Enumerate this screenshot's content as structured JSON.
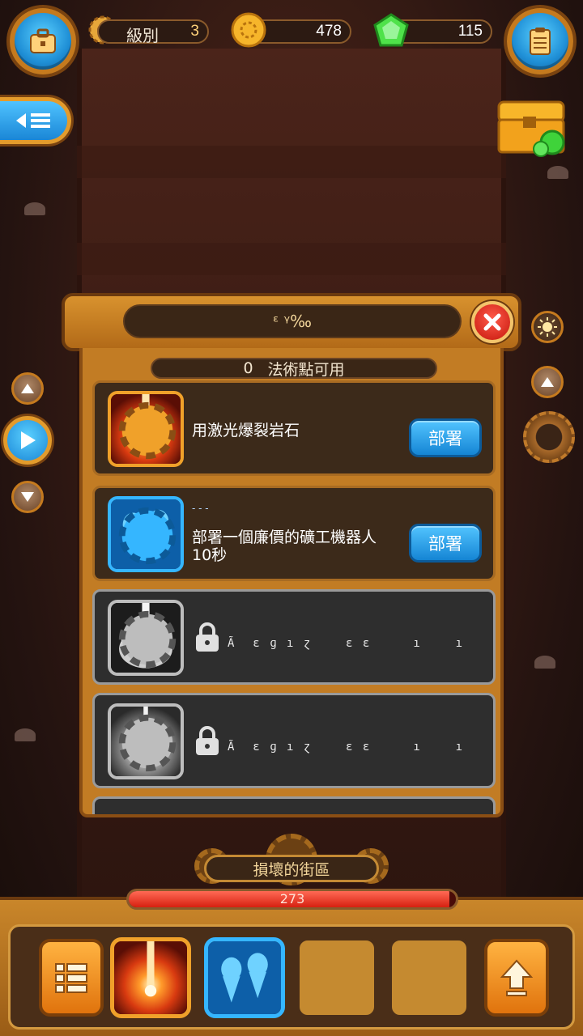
{
  "topbar": {
    "level_label": "級別",
    "level_value": "3",
    "coins": "478",
    "gems": "115"
  },
  "panel": {
    "title": "ᵋ ᵞ‰",
    "points_count": "0",
    "points_label": "法術點可用",
    "cards": [
      {
        "text": "用激光爆裂岩石",
        "button": "部署",
        "sub": ""
      },
      {
        "sub": "- - -",
        "text": "部署一個廉價的礦工機器人",
        "text2": "10秒",
        "button": "部署"
      },
      {
        "locked_text": "Ã  ε ɡ ı ɀ    ɛ ɛ     ı    ı     S"
      },
      {
        "locked_text": "Ã  ε ɡ ı ɀ    ɛ ɛ     ı    ı       ɾ"
      }
    ]
  },
  "bottom": {
    "zone_name": "損壞的街區",
    "hp_value": "273",
    "hp_fraction": 0.98
  },
  "colors": {
    "accent_orange": "#d8922e",
    "button_blue": "#1a86d6",
    "hp_red": "#d62010"
  },
  "icons": [
    "briefcase-icon",
    "gear-icon",
    "coin-icon",
    "gem-icon",
    "clipboard-icon",
    "back-menu-icon",
    "treasure-chest-icon",
    "arrow-up-icon",
    "play-icon",
    "arrow-down-icon",
    "sun-icon",
    "close-icon",
    "lock-icon",
    "list-icon",
    "upload-arrow-icon"
  ]
}
